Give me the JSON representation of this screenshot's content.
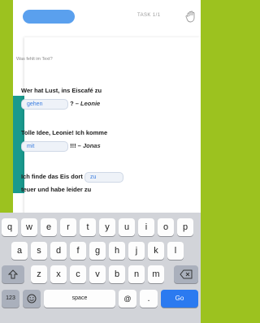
{
  "header": {
    "task_label": "TASK 1/1",
    "close_icon": "close-hand-icon"
  },
  "exercise": {
    "instruction": "Was fehlt im Text?",
    "items": [
      {
        "pre": "Wer hat Lust, ins Eiscafé zu",
        "blank": "gehen",
        "post": "? –",
        "author": "Leonie"
      },
      {
        "pre": "Tolle Idee, Leonie! Ich komme",
        "blank": "mit",
        "post": "!!! –",
        "author": "Jonas"
      },
      {
        "pre": "Ich finde das Eis dort",
        "blank": "zu",
        "post": "teuer und habe leider zu"
      }
    ]
  },
  "keyboard": {
    "row1": [
      "q",
      "w",
      "e",
      "r",
      "t",
      "y",
      "u",
      "i",
      "o",
      "p"
    ],
    "row2": [
      "a",
      "s",
      "d",
      "f",
      "g",
      "h",
      "j",
      "k",
      "l"
    ],
    "row3": [
      "z",
      "x",
      "c",
      "v",
      "b",
      "n",
      "m"
    ],
    "numbers_label": "123",
    "space_label": "space",
    "at_label": "@",
    "dot_label": ".",
    "go_label": "Go",
    "shift_icon": "shift-icon",
    "backspace_icon": "backspace-icon",
    "emoji_icon": "emoji-icon"
  },
  "colors": {
    "background": "#9cc21f",
    "accent_teal": "#1a9a8e",
    "progress": "#5aa0ee",
    "go_key": "#2b7af0"
  }
}
